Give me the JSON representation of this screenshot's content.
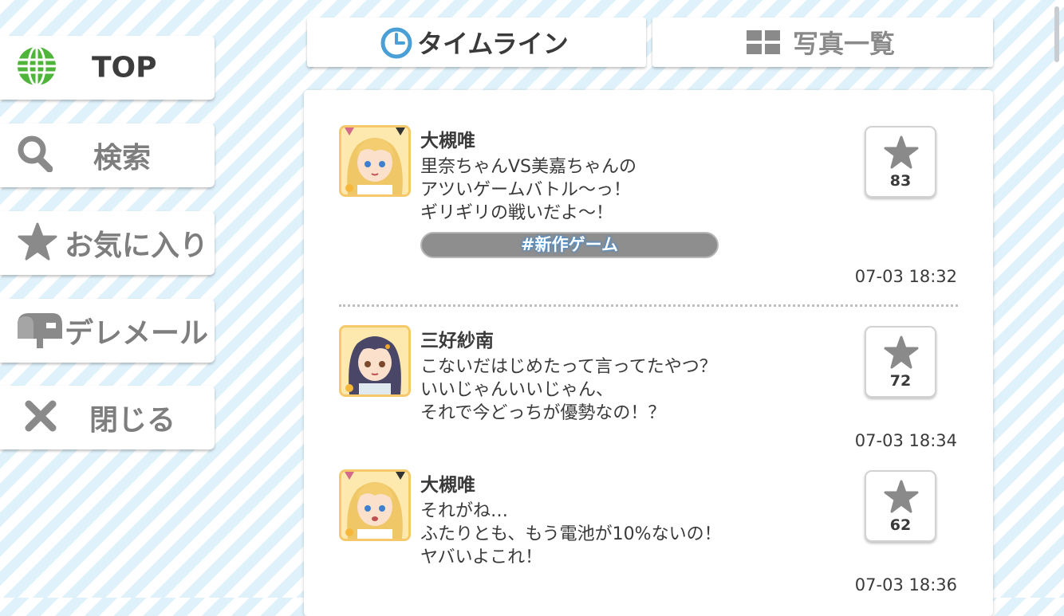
{
  "sidebar": {
    "items": [
      {
        "label": "TOP",
        "icon": "globe-icon",
        "active": true
      },
      {
        "label": "検索",
        "icon": "search-icon",
        "active": false
      },
      {
        "label": "お気に入り",
        "icon": "star-icon",
        "active": false
      },
      {
        "label": "デレメール",
        "icon": "mailbox-icon",
        "active": false
      },
      {
        "label": "閉じる",
        "icon": "close-icon",
        "active": false
      }
    ]
  },
  "tabs": [
    {
      "label": "タイムライン",
      "icon": "clock-icon",
      "selected": true
    },
    {
      "label": "写真一覧",
      "icon": "grid-icon",
      "selected": false
    }
  ],
  "posts": [
    {
      "author": "大槻唯",
      "lines": [
        "里奈ちゃんVS美嘉ちゃんの",
        "アツいゲームバトル〜っ！",
        "ギリギリの戦いだよ〜！"
      ],
      "hashtag": "#新作ゲーム",
      "likes": "83",
      "time": "07-03 18:32"
    },
    {
      "author": "三好紗南",
      "lines": [
        "こないだはじめたって言ってたやつ？",
        "いいじゃんいいじゃん、",
        "それで今どっちが優勢なの！？"
      ],
      "likes": "72",
      "time": "07-03 18:34"
    },
    {
      "author": "大槻唯",
      "lines": [
        "それがね…",
        "ふたりとも、もう電池が10%ないの！",
        "ヤバいよこれ！"
      ],
      "likes": "62",
      "time": "07-03 18:36"
    }
  ],
  "colors": {
    "accent_blue": "#4a9fd6",
    "globe_green": "#4fb53a",
    "disabled_gray": "#7e7e7e",
    "stripe_blue": "#dff1fb",
    "avatar_border": "#f5c96a"
  }
}
